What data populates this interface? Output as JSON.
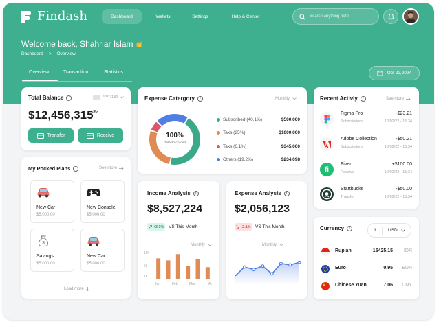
{
  "header": {
    "brand": "Findash",
    "nav": [
      "Dashboard",
      "Wallets",
      "Settings",
      "Help & Center"
    ],
    "search_placeholder": "Search anything here"
  },
  "welcome": {
    "title": "Welcome back, Shahriar Islam",
    "emoji": "👏"
  },
  "breadcrumb": {
    "home": "Dashboard",
    "sep": ">",
    "current": "Overview"
  },
  "tabs": [
    "Overview",
    "Transaction",
    "Statistics"
  ],
  "date": "Oct 22,2024",
  "balance": {
    "title": "Total Balance",
    "card_mask": "**** 7189",
    "amount": "$12,456,315",
    "transfer_label": "Transfer",
    "receive_label": "Receive"
  },
  "plans": {
    "title": "My Pocked Plans",
    "see_more": "See more",
    "items": [
      {
        "name": "New Car",
        "amount": "$5.000,00",
        "icon": "car-icon"
      },
      {
        "name": "New Console",
        "amount": "$5.000,00",
        "icon": "gamepad-icon"
      },
      {
        "name": "Savings",
        "amount": "$5.000,00",
        "icon": "money-bag-icon"
      },
      {
        "name": "New Car",
        "amount": "$5.000,00",
        "icon": "car-icon"
      }
    ],
    "load_more": "Load more"
  },
  "expense_category": {
    "title": "Expense Catergory",
    "period": "Monthly",
    "center_value": "100%",
    "center_label": "Data Recorded",
    "items": [
      {
        "label": "Subscribed (40.1%)",
        "value": "$500.000",
        "color": "#3aa98a",
        "pct": 40.1
      },
      {
        "label": "Taxs (25%)",
        "value": "$1000.000",
        "color": "#e08a54",
        "pct": 25
      },
      {
        "label": "Taxs (6.1%)",
        "value": "$345.000",
        "color": "#d65a6e",
        "pct": 6.1
      },
      {
        "label": "Others (19.2%)",
        "value": "$234.098",
        "color": "#4f7fe3",
        "pct": 19.2
      }
    ]
  },
  "income": {
    "title": "Income Analysis",
    "amount": "$8,527,224",
    "badge": "+3.1%",
    "vs_label": "VS This Month",
    "period": "Monthly",
    "chart_data": {
      "type": "bar",
      "categories": [
        "Jan",
        "Feb",
        "Mar",
        "Aj"
      ],
      "values": [
        7.8,
        7.0,
        9.4,
        5.0,
        7.6,
        4.4
      ],
      "y_ticks": [
        "10k",
        "5k",
        "1k"
      ],
      "ylim": [
        0,
        10
      ],
      "color": "#e08a54"
    }
  },
  "expense_analysis": {
    "title": "Expense Analysis",
    "amount": "$2,056,123",
    "badge": "-2.1%",
    "vs_label": "VS This Month",
    "period": "Monthly",
    "chart_data": {
      "type": "area",
      "values": [
        2.4,
        5.5,
        4.6,
        5.8,
        3.1,
        6.7,
        6.2,
        7.1
      ],
      "ylim": [
        0,
        10
      ],
      "color": "#4f7fe3"
    }
  },
  "activity": {
    "title": "Recent Activiy",
    "see_more": "See more",
    "items": [
      {
        "name": "Figma Pro",
        "sub": "Subscriptions",
        "amount": "-$23.21",
        "time": "10/02/22 - 15.34",
        "icon": "figma-icon"
      },
      {
        "name": "Adobe Collection",
        "sub": "Subscriptions",
        "amount": "-$50.21",
        "time": "10/02/22 - 15.34",
        "icon": "adobe-icon"
      },
      {
        "name": "Fiverr",
        "sub": "Receive",
        "amount": "+$100.00",
        "time": "10/02/22 - 15.34",
        "icon": "fiverr-icon"
      },
      {
        "name": "Startbucks",
        "sub": "Transfer",
        "amount": "-$50.00",
        "time": "10/02/22 - 15.34",
        "icon": "starbucks-icon"
      }
    ]
  },
  "currency": {
    "title": "Currency",
    "qty": "1",
    "base": "USD",
    "items": [
      {
        "name": "Rupiah",
        "value": "15425,15",
        "code": "IDR",
        "icon": "indonesia-flag-icon"
      },
      {
        "name": "Euro",
        "value": "0,95",
        "code": "EUR",
        "icon": "eu-flag-icon"
      },
      {
        "name": "Chinese Yuan",
        "value": "7,06",
        "code": "CNY",
        "icon": "china-flag-icon"
      }
    ]
  },
  "colors": {
    "brand": "#3fb08f",
    "background": "#f3f4f6",
    "card": "#ffffff"
  }
}
